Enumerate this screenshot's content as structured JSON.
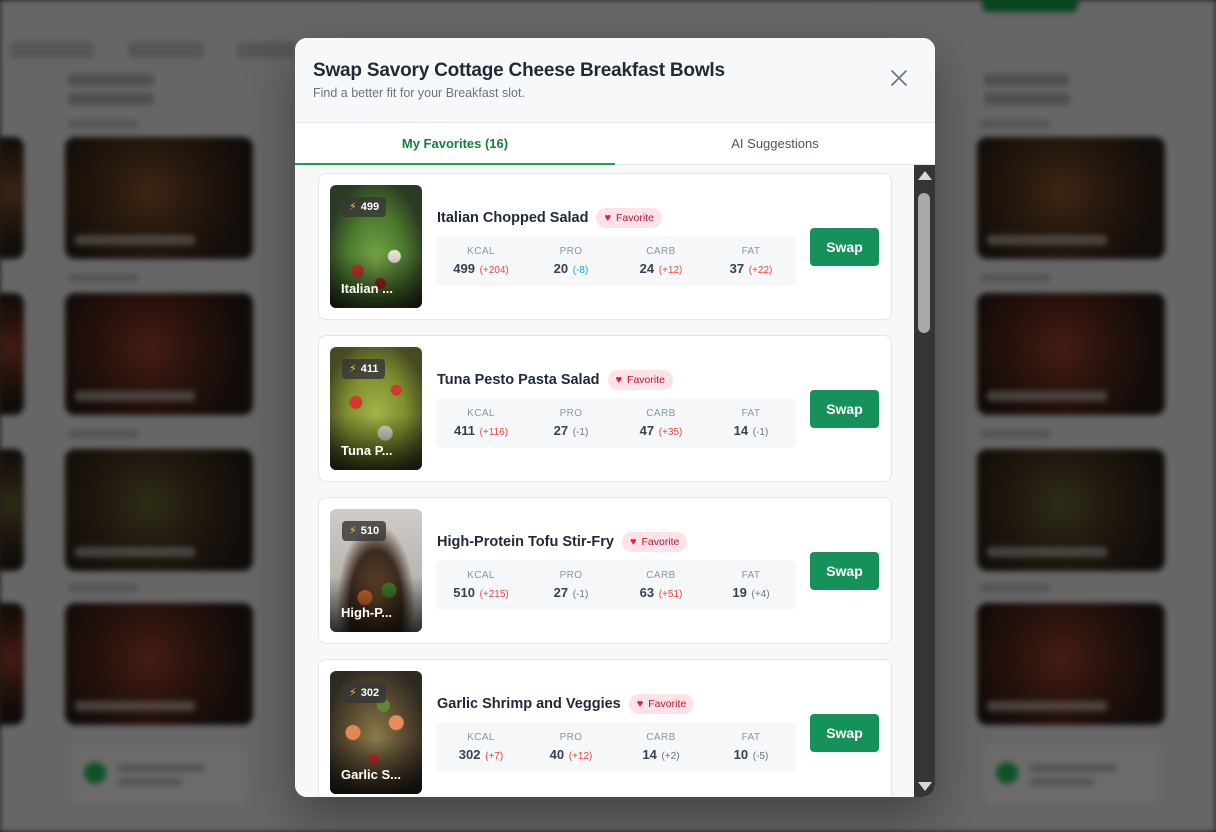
{
  "modal": {
    "title": "Swap Savory Cottage Cheese Breakfast Bowls",
    "subtitle": "Find a better fit for your Breakfast slot."
  },
  "tabs": [
    {
      "label": "My Favorites (16)",
      "active": true
    },
    {
      "label": "AI Suggestions",
      "active": false
    }
  ],
  "macro_labels": {
    "kcal": "KCAL",
    "pro": "PRO",
    "carb": "CARB",
    "fat": "FAT"
  },
  "swap_label": "Swap",
  "favorite_label": "Favorite",
  "recipes": [
    {
      "name": "Italian Chopped Salad",
      "thumb_name": "Italian ...",
      "kcal_badge": "499",
      "kcal": "499",
      "kcal_delta": "(+204)",
      "pro": "20",
      "pro_delta": "(-8)",
      "carb": "24",
      "carb_delta": "(+12)",
      "fat": "37",
      "fat_delta": "(+22)"
    },
    {
      "name": "Tuna Pesto Pasta Salad",
      "thumb_name": "Tuna P...",
      "kcal_badge": "411",
      "kcal": "411",
      "kcal_delta": "(+116)",
      "pro": "27",
      "pro_delta": "(-1)",
      "carb": "47",
      "carb_delta": "(+35)",
      "fat": "14",
      "fat_delta": "(-1)"
    },
    {
      "name": "High-Protein Tofu Stir-Fry",
      "thumb_name": "High-P...",
      "kcal_badge": "510",
      "kcal": "510",
      "kcal_delta": "(+215)",
      "pro": "27",
      "pro_delta": "(-1)",
      "carb": "63",
      "carb_delta": "(+51)",
      "fat": "19",
      "fat_delta": "(+4)"
    },
    {
      "name": "Garlic Shrimp and Veggies",
      "thumb_name": "Garlic S...",
      "kcal_badge": "302",
      "kcal": "302",
      "kcal_delta": "(+7)",
      "pro": "40",
      "pro_delta": "(+12)",
      "carb": "14",
      "carb_delta": "(+2)",
      "fat": "10",
      "fat_delta": "(-5)"
    }
  ],
  "colors": {
    "accent_green": "#16915a",
    "active_tab": "#15803d",
    "delta_positive": "#ef4444",
    "delta_protein_negative": "#0ea5e9",
    "favorite_bg": "#fde3e7"
  }
}
